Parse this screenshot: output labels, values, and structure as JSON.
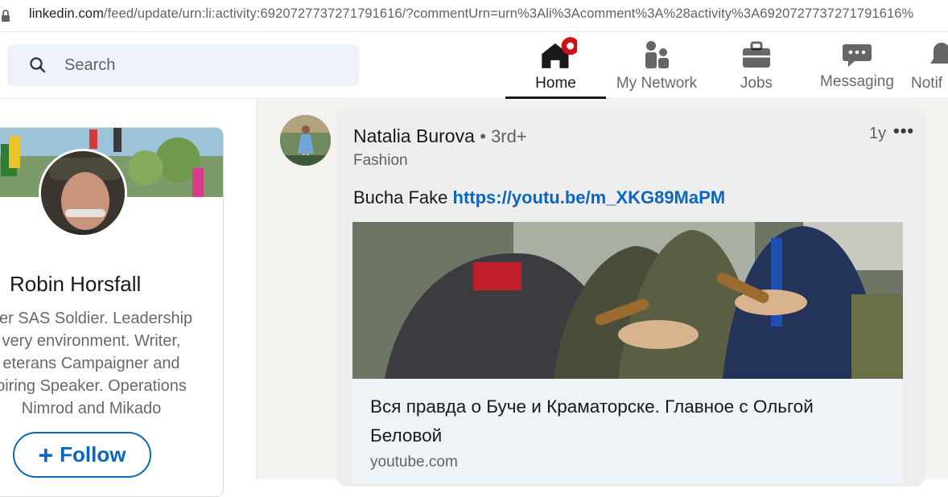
{
  "browser": {
    "url_host": "linkedin.com",
    "url_path": "/feed/update/urn:li:activity:6920727737271791616/?commentUrn=urn%3Ali%3Acomment%3A%28activity%3A6920727737271791616%"
  },
  "search": {
    "placeholder": "Search"
  },
  "nav": {
    "home": "Home",
    "network": "My Network",
    "jobs": "Jobs",
    "messaging": "Messaging",
    "notifications": "Notif"
  },
  "profile": {
    "name": "Robin Horsfall",
    "headline_lines": [
      "ner SAS Soldier. Leadership",
      "very environment. Writer,",
      "eterans Campaigner and",
      "piring Speaker. Operations",
      "Nimrod and Mikado"
    ],
    "follow_label": "Follow"
  },
  "post": {
    "author": "Natalia Burova",
    "degree": "• 3rd+",
    "author_sub": "Fashion",
    "time": "1y",
    "more": "•••",
    "text": "Bucha Fake ",
    "link": "https://youtu.be/m_XKG89MaPM",
    "media_title": "Вся правда о Буче и Краматорске. Главное с Ольгой Беловой",
    "media_source": "youtube.com"
  },
  "colors": {
    "brand_blue": "#0a66c2",
    "search_bg": "#edf3f8",
    "notification_red": "#cc1016"
  }
}
